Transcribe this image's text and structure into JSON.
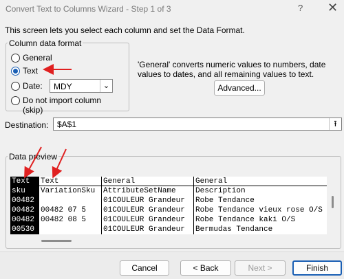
{
  "window": {
    "title": "Convert Text to Columns Wizard - Step 1 of 3",
    "help_label": "?",
    "close_label": "✕"
  },
  "intro": "This screen lets you select each column and set the Data Format.",
  "format_group": {
    "label": "Column data format",
    "options": [
      {
        "label": "General",
        "selected": false
      },
      {
        "label": "Text",
        "selected": true
      },
      {
        "label": "Date:",
        "selected": false
      },
      {
        "label": "Do not import column (skip)",
        "selected": false
      }
    ],
    "date_format": "MDY"
  },
  "hint": "'General' converts numeric values to numbers, date values to dates, and all remaining values to text.",
  "advanced_label": "Advanced...",
  "destination": {
    "label": "Destination:",
    "value": "$A$1"
  },
  "preview": {
    "label": "Data preview",
    "columns": [
      {
        "header": "Text",
        "cells": [
          "sku",
          "00482",
          "00482",
          "00482",
          "00530"
        ]
      },
      {
        "header": "Text",
        "cells": [
          "VariationSku",
          "",
          "00482 07 5",
          "00482 08 5",
          ""
        ]
      },
      {
        "header": "General",
        "cells": [
          "AttributeSetName",
          "01COULEUR Grandeur",
          "01COULEUR Grandeur",
          "01COULEUR Grandeur",
          "01COULEUR Grandeur"
        ]
      },
      {
        "header": "General",
        "cells": [
          "Description",
          "Robe Tendance",
          "Robe Tendance vieux rose O/S",
          "Robe Tendance kaki O/S",
          "Bermudas Tendance"
        ]
      }
    ]
  },
  "buttons": {
    "cancel": "Cancel",
    "back": "< Back",
    "next": "Next >",
    "finish": "Finish"
  },
  "colors": {
    "accent": "#1a5fb4",
    "annotation_arrow": "#e02020"
  }
}
